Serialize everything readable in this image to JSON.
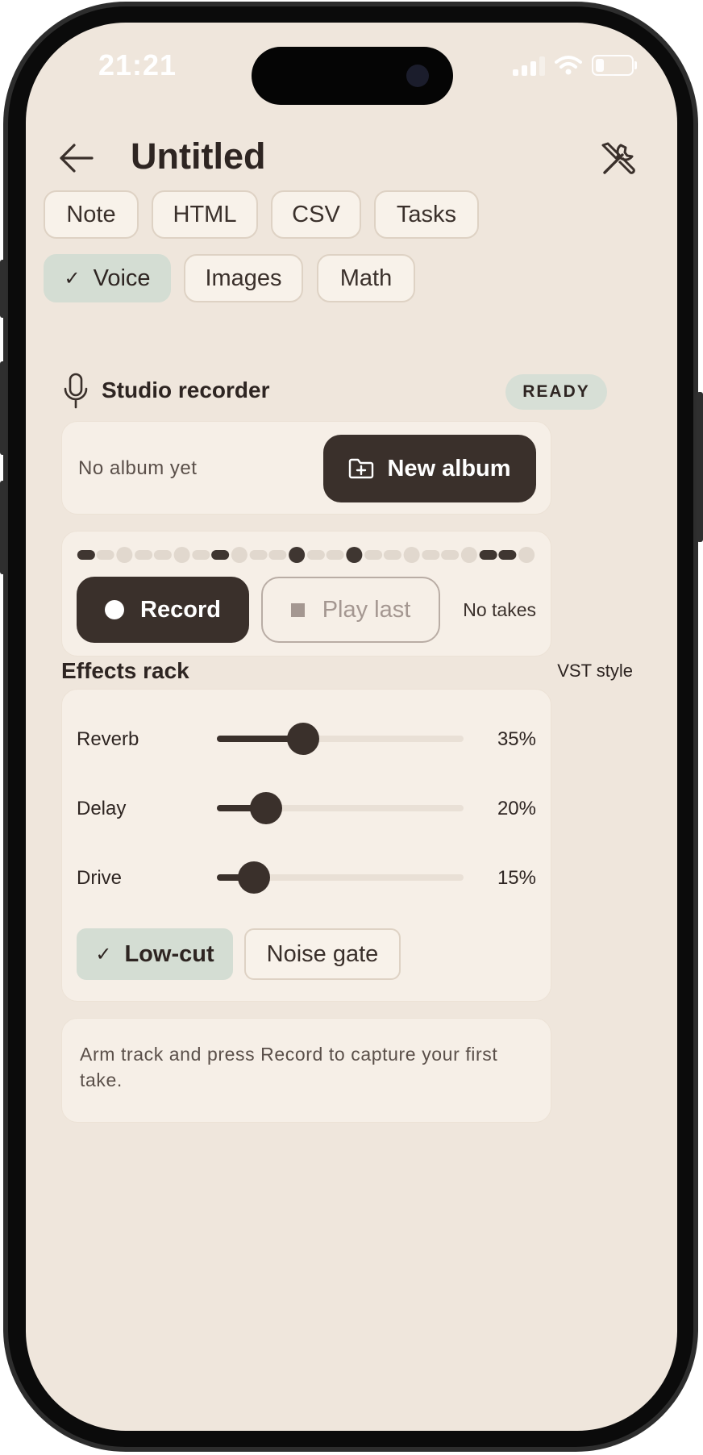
{
  "status_bar": {
    "time": "21:21"
  },
  "header": {
    "title": "Untitled"
  },
  "tabs": [
    {
      "label": "Note"
    },
    {
      "label": "HTML"
    },
    {
      "label": "CSV"
    },
    {
      "label": "Tasks"
    },
    {
      "label": "Voice",
      "selected": true
    },
    {
      "label": "Images"
    },
    {
      "label": "Math"
    }
  ],
  "recorder": {
    "title": "Studio recorder",
    "status": "READY",
    "album_text": "No album yet",
    "new_album_label": "New album",
    "record_label": "Record",
    "play_last_label": "Play last",
    "takes_text": "No takes"
  },
  "effects": {
    "title": "Effects rack",
    "style_label": "VST style",
    "sliders": [
      {
        "label": "Reverb",
        "value": 35,
        "display": "35%"
      },
      {
        "label": "Delay",
        "value": 20,
        "display": "20%"
      },
      {
        "label": "Drive",
        "value": 15,
        "display": "15%"
      }
    ],
    "toggles": [
      {
        "label": "Low-cut",
        "on": true
      },
      {
        "label": "Noise gate",
        "on": false
      }
    ]
  },
  "hint": "Arm track and press Record to capture your first take.",
  "colors": {
    "background": "#efe6dc",
    "accent_dark": "#3a302b",
    "selected_chip": "#d4ddd3"
  }
}
